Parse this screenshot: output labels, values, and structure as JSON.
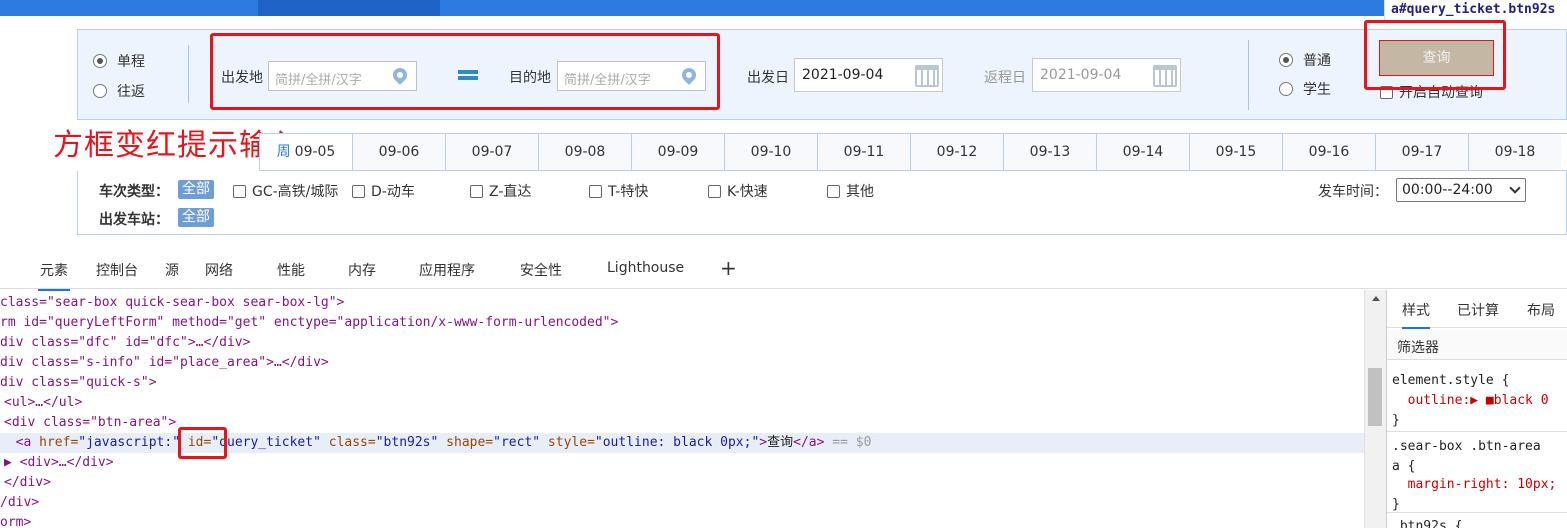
{
  "tooltip": {
    "label": "a#query_ticket.btn92s"
  },
  "trip": {
    "oneway": "单程",
    "roundtrip": "往返"
  },
  "from": {
    "label": "出发地",
    "placeholder": "简拼/全拼/汉字"
  },
  "to": {
    "label": "目的地",
    "placeholder": "简拼/全拼/汉字"
  },
  "depart": {
    "label": "出发日",
    "value": "2021-09-04"
  },
  "return": {
    "label": "返程日",
    "value": "2021-09-04"
  },
  "passenger": {
    "normal": "普通",
    "student": "学生"
  },
  "query": {
    "label": "查询",
    "auto": "开启自动查询"
  },
  "annotation": "方框变红提示输入",
  "dates": [
    "09-05",
    "09-06",
    "09-07",
    "09-08",
    "09-09",
    "09-10",
    "09-11",
    "09-12",
    "09-13",
    "09-14",
    "09-15",
    "09-16",
    "09-17",
    "09-18"
  ],
  "date_tab_prefix": "周",
  "filters": {
    "train_type_label": "车次类型：",
    "all": "全部",
    "types": [
      "GC-高铁/城际",
      "D-动车",
      "Z-直达",
      "T-特快",
      "K-快速",
      "其他"
    ],
    "station_label": "出发车站：",
    "time_label": "发车时间：",
    "time_value": "00:00--24:00"
  },
  "devtools": {
    "tabs": [
      "元素",
      "控制台",
      "源",
      "网络",
      "性能",
      "内存",
      "应用程序",
      "安全性",
      "Lighthouse"
    ],
    "dom_lines": [
      "class=\"sear-box quick-sear-box sear-box-lg\">",
      "rm id=\"queryLeftForm\" method=\"get\" enctype=\"application/x-www-form-urlencoded\">",
      "div class=\"dfc\" id=\"dfc\">…</div>",
      "div class=\"s-info\" id=\"place_area\">…</div>",
      "div class=\"quick-s\">",
      "<ul>…</ul>",
      "<div class=\"btn-area\">",
      "",
      "▶ <div>…</div>",
      "</div>",
      "/div>",
      "orm>"
    ],
    "selected_line": {
      "open": "<a",
      "href_attr": " href=",
      "href_val": "\"javascript:\"",
      "id_attr": " id=",
      "id_val": "\"query_ticket\"",
      "class_attr": " class=",
      "class_val": "\"btn92s\"",
      "shape_attr": " shape=",
      "shape_val": "\"rect\"",
      "style_attr": " style=",
      "style_val": "\"outline: black 0px;\"",
      "gt": ">",
      "text": "查询",
      "close": "</a>",
      "marker": " == $0"
    },
    "styles_tabs": [
      "样式",
      "已计算",
      "布局"
    ],
    "styles_filter": "筛选器",
    "css": [
      "element.style {",
      "  outline:▶ ■black 0",
      "}",
      ".sear-box .btn-area",
      "a {",
      "  margin-right: 10px;",
      "}",
      ".btn92s {"
    ]
  },
  "colors": {
    "accent": "#2d7be0",
    "annotation_red": "#e8141b",
    "query_btn": "#c4b8a4"
  }
}
